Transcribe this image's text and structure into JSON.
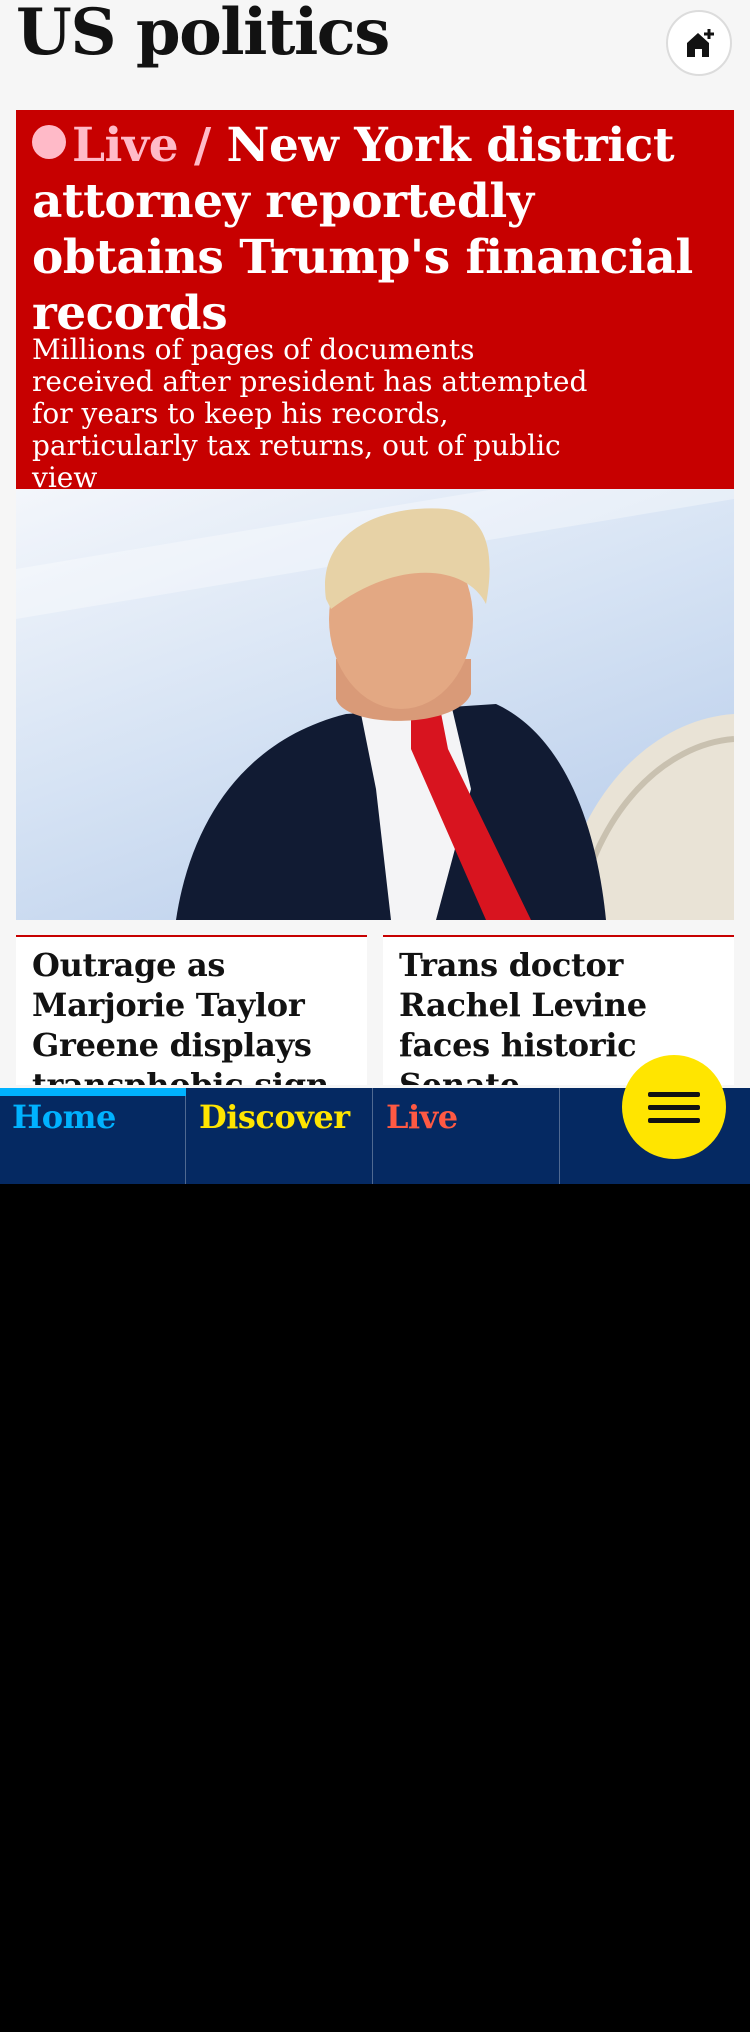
{
  "header": {
    "title": "US politics",
    "home_add_icon": "home-add-icon"
  },
  "lead_story": {
    "kicker": "Live /",
    "headline": "New York district attorney reportedly obtains Trump's financial records",
    "standfirst": "Millions of pages of documents received after president has attempted for years to keep his records, particularly tax returns, out of public view"
  },
  "stories": [
    {
      "headline": "Outrage as Marjorie Taylor Greene displays transphobic sign in Congress"
    },
    {
      "headline": "Trans doctor Rachel Levine faces historic Senate confirmation hearing"
    }
  ],
  "bottom_nav": {
    "tabs": [
      {
        "label": "Home",
        "color": "#00b2ff",
        "active": true
      },
      {
        "label": "Discover",
        "color": "#ffe500",
        "active": false
      },
      {
        "label": "Live",
        "color": "#ff5943",
        "active": false
      },
      {
        "label": "",
        "color": "#ffffff",
        "active": false
      }
    ],
    "menu_icon": "hamburger-menu-icon"
  },
  "colors": {
    "brand_red": "#c70000",
    "nav_blue": "#052962",
    "menu_yellow": "#ffe500"
  }
}
